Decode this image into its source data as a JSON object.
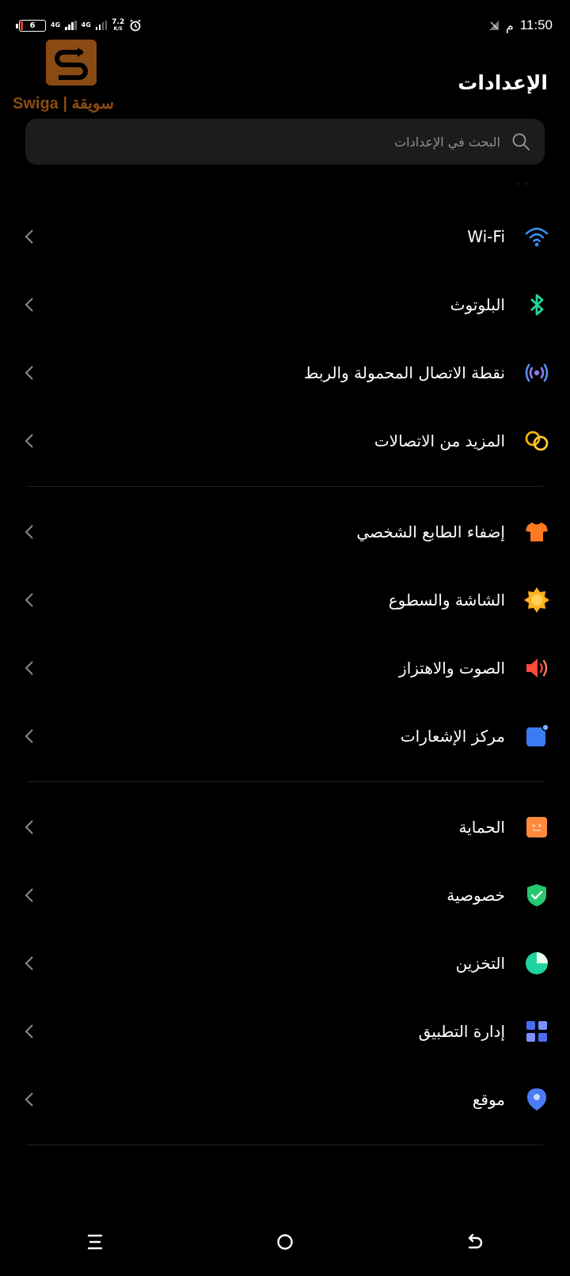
{
  "status_bar": {
    "battery": "6",
    "net1": "4G",
    "net2": "4G",
    "speed_value": "7.2",
    "speed_unit": "K/S",
    "time": "11:50",
    "ampm": "م"
  },
  "watermark": {
    "text": "Swiga | سويقة"
  },
  "header": {
    "title": "الإعدادات",
    "search_placeholder": "البحث في الإعدادات"
  },
  "sections": [
    {
      "items": [
        {
          "label": "Wi-Fi",
          "icon": "wifi-icon",
          "color": "#3b8ef0"
        },
        {
          "label": "البلوتوث",
          "icon": "bluetooth-icon",
          "color": "#26d39a"
        },
        {
          "label": "نقطة الاتصال المحمولة والربط",
          "icon": "hotspot-icon",
          "color": "#8a7cf0"
        },
        {
          "label": "المزيد من الاتصالات",
          "icon": "link-icon",
          "color": "#f0b400"
        }
      ]
    },
    {
      "items": [
        {
          "label": "إضفاء الطابع الشخصي",
          "icon": "shirt-icon",
          "color": "#ff7a1f"
        },
        {
          "label": "الشاشة والسطوع",
          "icon": "brightness-icon",
          "color": "#ffb020"
        },
        {
          "label": "الصوت والاهتزاز",
          "icon": "speaker-icon",
          "color": "#ff4a3d"
        },
        {
          "label": "مركز الإشعارات",
          "icon": "notification-icon",
          "color": "#3b7cf5"
        }
      ]
    },
    {
      "items": [
        {
          "label": "الحماية",
          "icon": "security-icon",
          "color": "#ff8a3d"
        },
        {
          "label": "خصوصية",
          "icon": "shield-icon",
          "color": "#26c96f"
        },
        {
          "label": "التخزين",
          "icon": "storage-icon",
          "color": "#1ed3a0"
        },
        {
          "label": "إدارة التطبيق",
          "icon": "apps-icon",
          "color": "#4a6cf0"
        },
        {
          "label": "موقع",
          "icon": "location-icon",
          "color": "#4a7cf5"
        }
      ]
    }
  ]
}
